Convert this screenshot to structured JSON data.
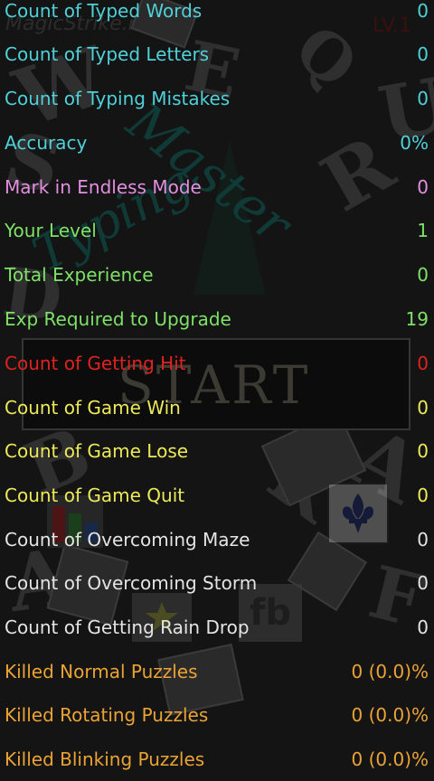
{
  "background": {
    "site_watermark": "MagicStrike.ru",
    "level_badge": "LV.1",
    "title_word_1": "Master",
    "title_word_2": "Typing",
    "start_button": "START",
    "fb_label": "fb",
    "letters": [
      "W",
      "E",
      "Q",
      "U",
      "S",
      "R",
      "D",
      "A",
      "B",
      "K",
      "A",
      "F"
    ]
  },
  "colors": {
    "cyan": "#4fd1d9",
    "magenta": "#e38ee0",
    "green": "#7de266",
    "red": "#e0231f",
    "yellow": "#ecea58",
    "white": "#e4e4e4",
    "orange": "#eba335"
  },
  "stats": [
    {
      "label": "Count of Typed Words",
      "value": "0",
      "color": "cyan"
    },
    {
      "label": "Count of Typed Letters",
      "value": "0",
      "color": "cyan"
    },
    {
      "label": "Count of Typing Mistakes",
      "value": "0",
      "color": "cyan"
    },
    {
      "label": "Accuracy",
      "value": "0%",
      "color": "cyan"
    },
    {
      "label": "Mark in Endless Mode",
      "value": "0",
      "color": "magenta"
    },
    {
      "label": "Your Level",
      "value": "1",
      "color": "green"
    },
    {
      "label": "Total Experience",
      "value": "0",
      "color": "green"
    },
    {
      "label": "Exp Required to Upgrade",
      "value": "19",
      "color": "green"
    },
    {
      "label": "Count of Getting Hit",
      "value": "0",
      "color": "red"
    },
    {
      "label": "Count of Game Win",
      "value": "0",
      "color": "yellow"
    },
    {
      "label": "Count of Game Lose",
      "value": "0",
      "color": "yellow"
    },
    {
      "label": "Count of Game Quit",
      "value": "0",
      "color": "yellow"
    },
    {
      "label": "Count of Overcoming Maze",
      "value": "0",
      "color": "white"
    },
    {
      "label": "Count of Overcoming Storm",
      "value": "0",
      "color": "white"
    },
    {
      "label": "Count of Getting Rain Drop",
      "value": "0",
      "color": "white"
    },
    {
      "label": "Killed Normal Puzzles",
      "value": "0 (0.0)%",
      "color": "orange"
    },
    {
      "label": "Killed Rotating Puzzles",
      "value": "0 (0.0)%",
      "color": "orange"
    },
    {
      "label": "Killed Blinking Puzzles",
      "value": "0 (0.0)%",
      "color": "orange"
    }
  ]
}
